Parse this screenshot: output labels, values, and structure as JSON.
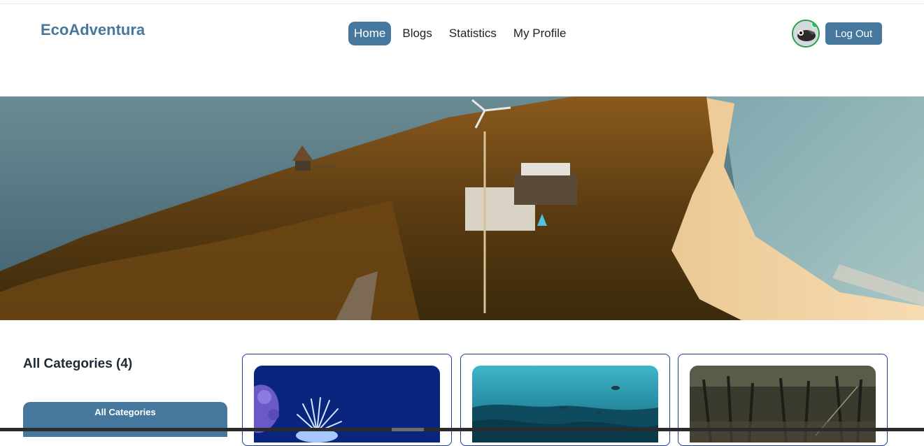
{
  "brand": {
    "name": "EcoAdventura",
    "color": "#45789c"
  },
  "nav": {
    "items": [
      {
        "label": "Home",
        "active": true
      },
      {
        "label": "Blogs",
        "active": false
      },
      {
        "label": "Statistics",
        "active": false
      },
      {
        "label": "My Profile",
        "active": false
      }
    ]
  },
  "user": {
    "avatar_icon": "user-avatar",
    "status": "online",
    "status_color": "#22c55e",
    "logout_label": "Log Out"
  },
  "hero": {
    "image": "aerial-island-beach-photo"
  },
  "sidebar": {
    "title": "All Categories (4)",
    "button_label": "All Categories"
  },
  "cards": [
    {
      "image": "coral-anemone-photo"
    },
    {
      "image": "underwater-reef-photo"
    },
    {
      "image": "mangrove-roots-photo"
    }
  ],
  "colors": {
    "accent": "#45789c",
    "card_border": "#1e3a8a"
  }
}
